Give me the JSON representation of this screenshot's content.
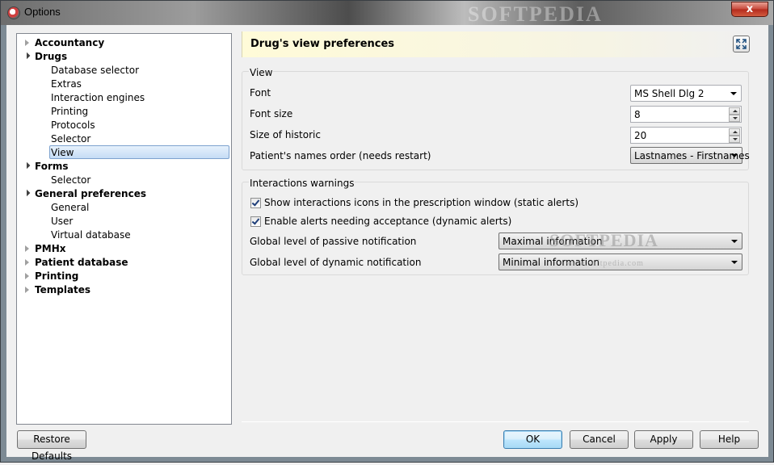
{
  "window": {
    "title": "Options",
    "close_glyph": "x",
    "watermark": "SOFTPEDIA"
  },
  "tree": [
    {
      "label": "Accountancy",
      "level": 0,
      "expanded": false
    },
    {
      "label": "Drugs",
      "level": 0,
      "expanded": true
    },
    {
      "label": "Database selector",
      "level": 1
    },
    {
      "label": "Extras",
      "level": 1
    },
    {
      "label": "Interaction engines",
      "level": 1
    },
    {
      "label": "Printing",
      "level": 1
    },
    {
      "label": "Protocols",
      "level": 1
    },
    {
      "label": "Selector",
      "level": 1
    },
    {
      "label": "View",
      "level": 1,
      "selected": true
    },
    {
      "label": "Forms",
      "level": 0,
      "expanded": true
    },
    {
      "label": "Selector",
      "level": 1
    },
    {
      "label": "General preferences",
      "level": 0,
      "expanded": true
    },
    {
      "label": "General",
      "level": 1
    },
    {
      "label": "User",
      "level": 1
    },
    {
      "label": "Virtual database",
      "level": 1
    },
    {
      "label": "PMHx",
      "level": 0,
      "expanded": false
    },
    {
      "label": "Patient database",
      "level": 0,
      "expanded": false
    },
    {
      "label": "Printing",
      "level": 0,
      "expanded": false
    },
    {
      "label": "Templates",
      "level": 0,
      "expanded": false
    }
  ],
  "panel": {
    "title": "Drug's view preferences",
    "view_group": {
      "title": "View",
      "font_label": "Font",
      "font_value": "MS Shell Dlg 2",
      "font_size_label": "Font size",
      "font_size_value": "8",
      "historic_label": "Size of historic",
      "historic_value": "20",
      "names_order_label": "Patient's names order (needs restart)",
      "names_order_value": "Lastnames - Firstnames"
    },
    "interactions_group": {
      "title": "Interactions warnings",
      "check1_label": "Show interactions icons in the prescription window (static alerts)",
      "check1_checked": true,
      "check2_label": "Enable alerts needing acceptance (dynamic alerts)",
      "check2_checked": true,
      "passive_label": "Global level of passive notification",
      "passive_value": "Maximal information",
      "dynamic_label": "Global level of dynamic notification",
      "dynamic_value": "Minimal information",
      "watermark_big": "SOFTPEDIA",
      "watermark_small": "www.softpedia.com"
    }
  },
  "buttons": {
    "restore": "Restore Defaults",
    "ok": "OK",
    "cancel": "Cancel",
    "apply": "Apply",
    "help": "Help"
  },
  "icons": {
    "app": "options-app-icon",
    "collapsed": "triangle-right-icon",
    "expanded": "triangle-down-icon",
    "expand_panel": "expand-icon"
  }
}
